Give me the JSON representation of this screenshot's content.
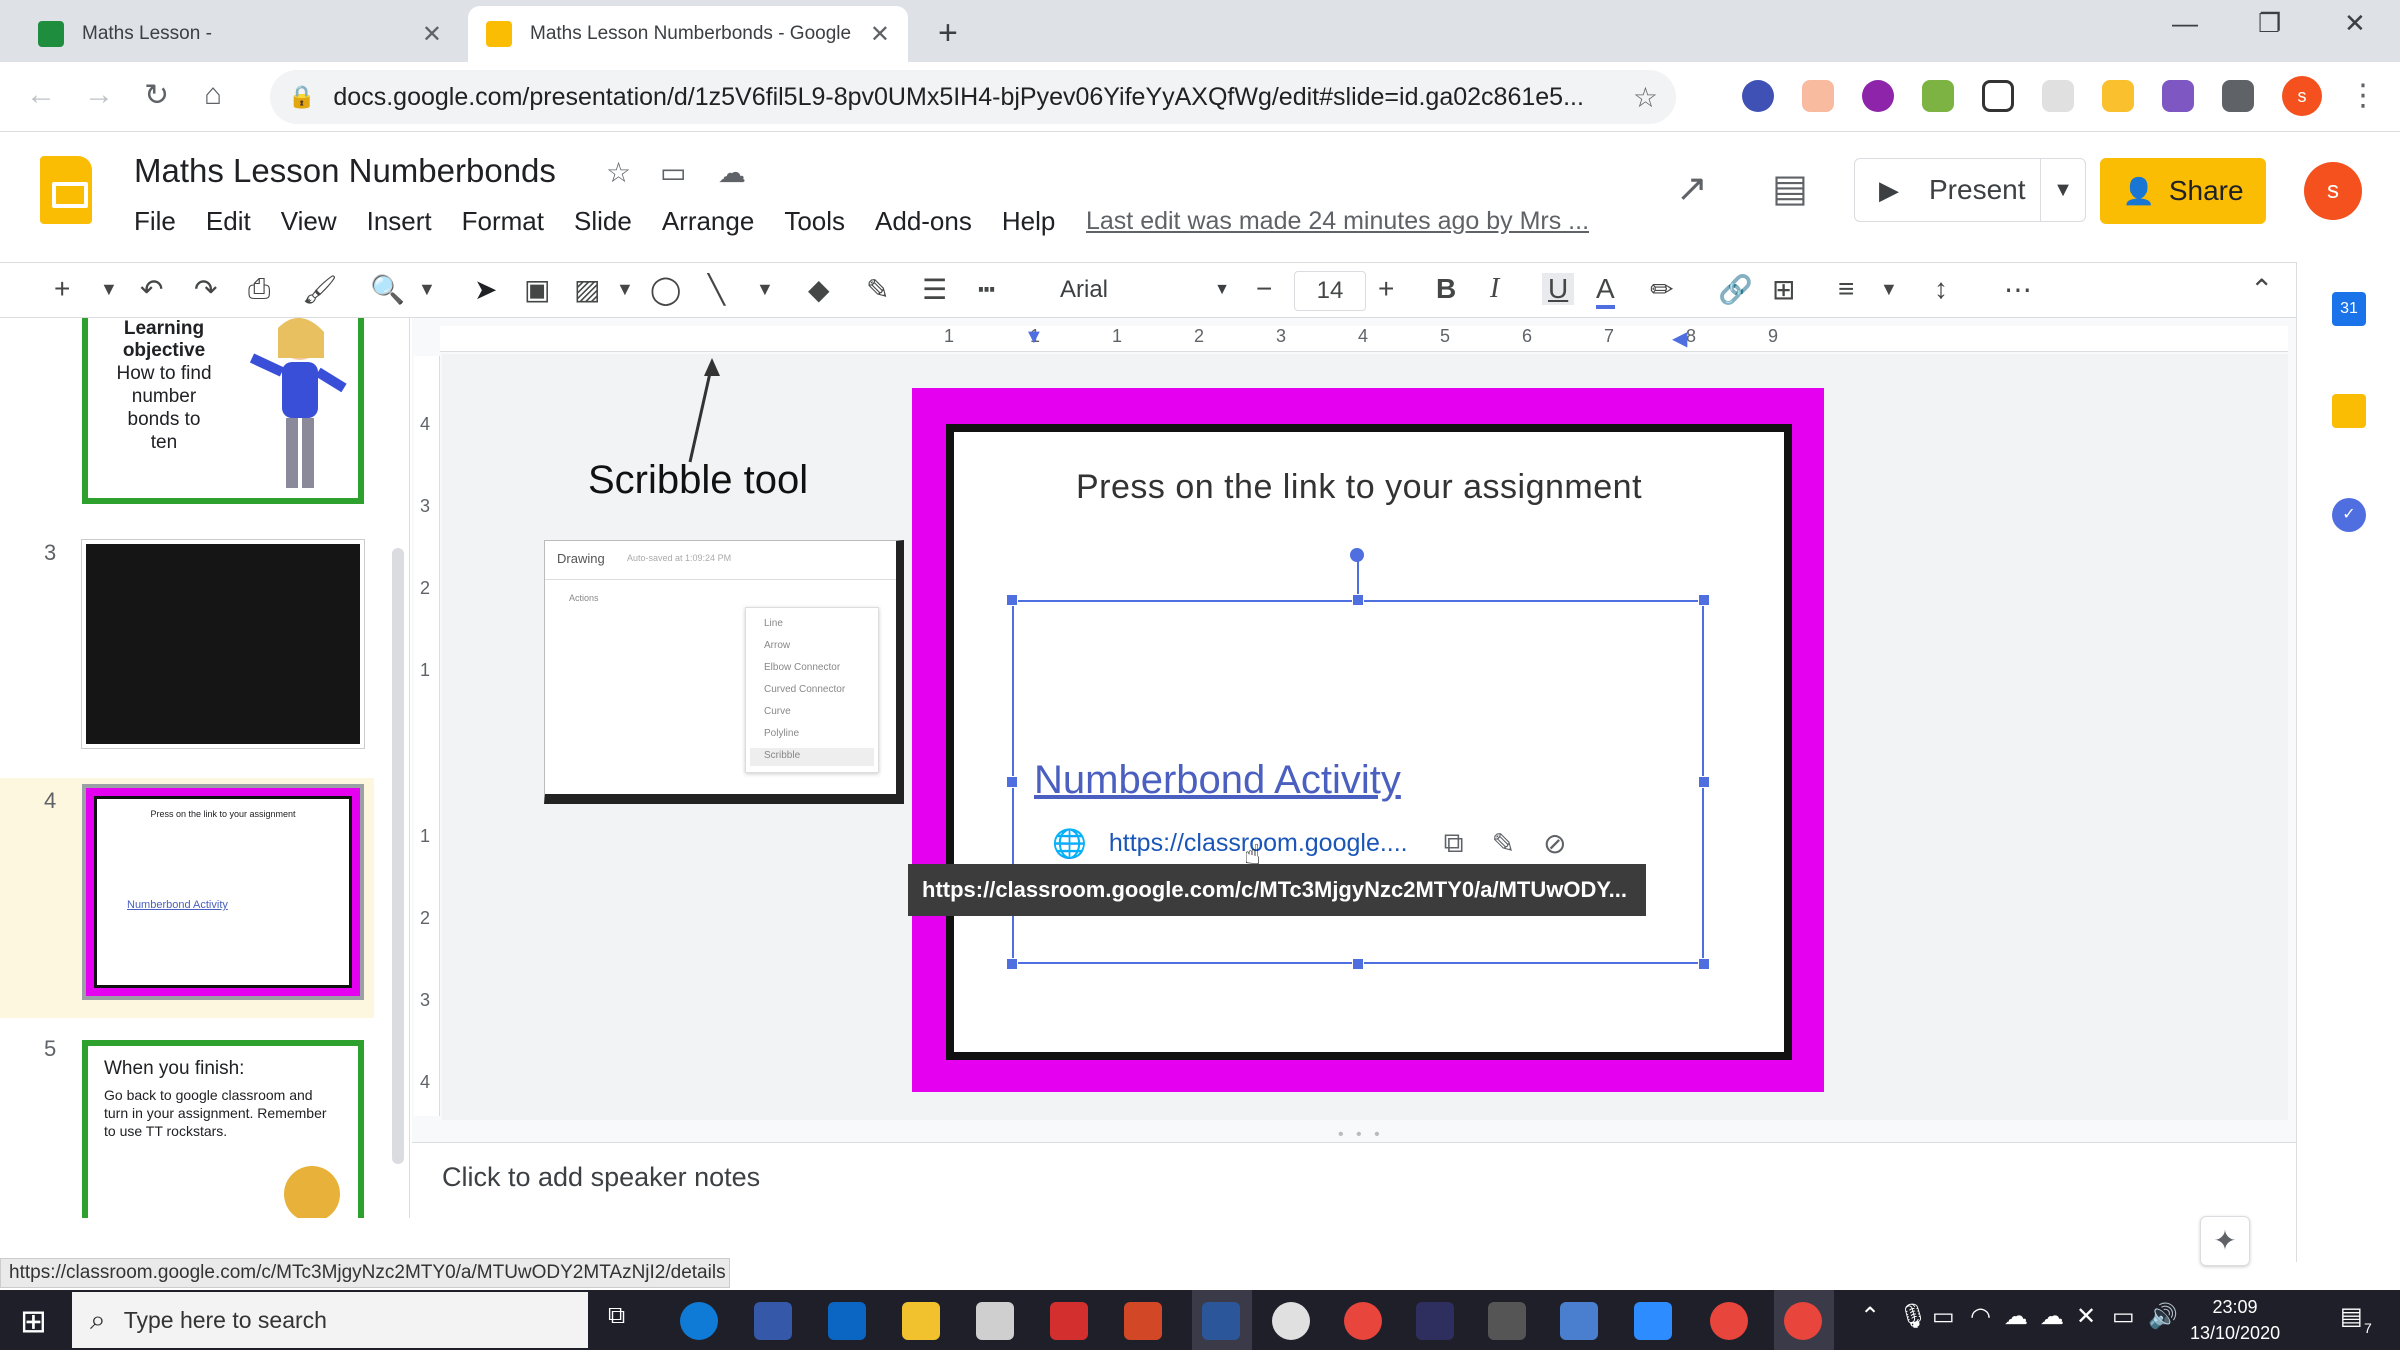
{
  "browser": {
    "tabs": [
      {
        "title": "Maths Lesson -",
        "active": false
      },
      {
        "title": "Maths Lesson Numberbonds - Google",
        "active": true
      }
    ],
    "url": "docs.google.com/presentation/d/1z5V6fil5L9-8pv0UMx5IH4-bjPyev06YifeYyAXQfWg/edit#slide=id.ga02c861e5..."
  },
  "app": {
    "doc_title": "Maths Lesson Numberbonds",
    "menu": [
      "File",
      "Edit",
      "View",
      "Insert",
      "Format",
      "Slide",
      "Arrange",
      "Tools",
      "Add-ons",
      "Help"
    ],
    "last_edit": "Last edit was made 24 minutes ago by Mrs ...",
    "present_label": "Present",
    "share_label": "Share",
    "avatar_initial": "s"
  },
  "toolbar": {
    "font": "Arial",
    "font_size": "14"
  },
  "ruler": {
    "h_ticks": [
      "1",
      "1",
      "1",
      "2",
      "3",
      "4",
      "5",
      "6",
      "7",
      "8",
      "9"
    ],
    "v_ticks": [
      "4",
      "3",
      "2",
      "1",
      "1",
      "2",
      "3",
      "4"
    ]
  },
  "filmstrip": {
    "slides": [
      {
        "num": "",
        "text_title": "Learning objective",
        "text_body": "How to find number bonds to ten"
      },
      {
        "num": "3"
      },
      {
        "num": "4",
        "heading": "Press on the link to your assignment",
        "link": "Numberbond Activity"
      },
      {
        "num": "5",
        "title": "When you finish:",
        "body": "Go back to google classroom and turn in your assignment. Remember to use TT rockstars."
      }
    ]
  },
  "slide": {
    "heading": "Press on the link to your assignment",
    "link_text": "Numberbond Activity",
    "popup_url": "https://classroom.google....",
    "tooltip_url": "https://classroom.google.com/c/MTc3MjgyNzc2MTY0/a/MTUwODY..."
  },
  "annotation": {
    "label": "Scribble tool",
    "drawing_title": "Drawing",
    "drawing_saved": "Auto-saved at 1:09:24 PM",
    "drawing_actions": "Actions",
    "drawing_menu": [
      "Line",
      "Arrow",
      "Elbow Connector",
      "Curved Connector",
      "Curve",
      "Polyline",
      "Scribble"
    ]
  },
  "notes_placeholder": "Click to add speaker notes",
  "status_url": "https://classroom.google.com/c/MTc3MjgyNzc2MTY0/a/MTUwODY2MTAzNjI2/details",
  "taskbar": {
    "search_placeholder": "Type here to search",
    "time": "23:09",
    "date": "13/10/2020",
    "notif_count": "7"
  },
  "colors": {
    "slide_border": "#e600f0",
    "thumb_green": "#2ea02e",
    "share_yellow": "#fbbc04",
    "link_blue": "#4a5fbf",
    "selection": "#4f6fe0"
  }
}
